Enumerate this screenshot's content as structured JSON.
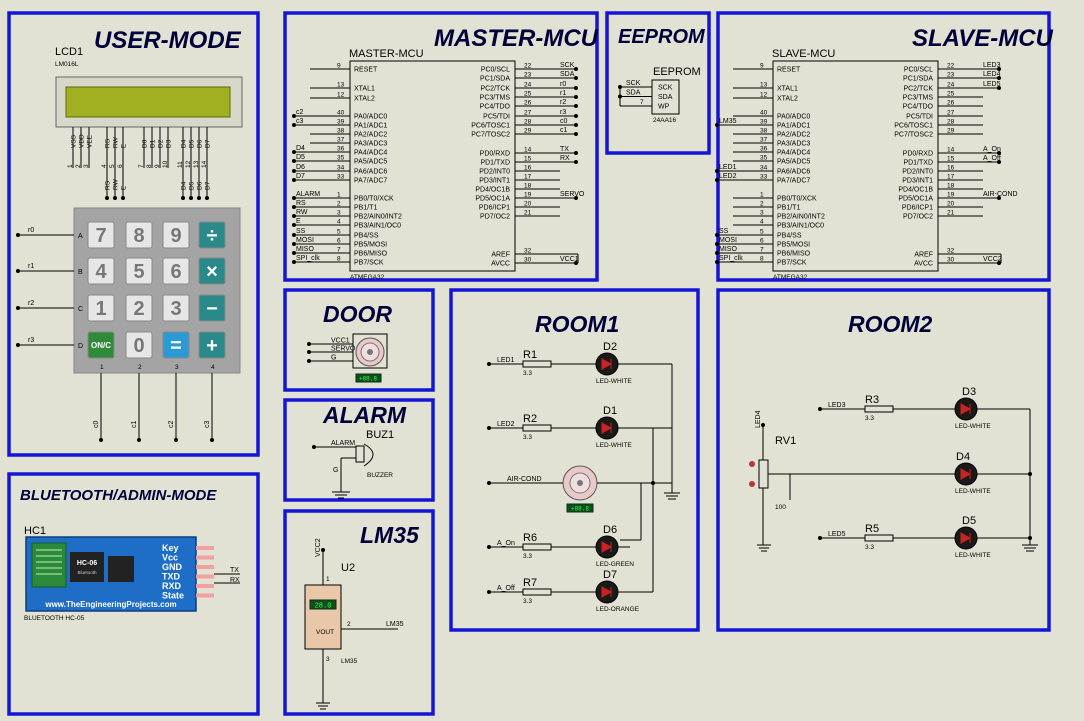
{
  "sections": {
    "user_mode": "USER-MODE",
    "bluetooth": "BLUETOOTH/ADMIN-MODE",
    "master": "MASTER-MCU",
    "eeprom": "EEPROM",
    "slave": "SLAVE-MCU",
    "door": "DOOR",
    "alarm": "ALARM",
    "lm35": "LM35",
    "room1": "ROOM1",
    "room2": "ROOM2"
  },
  "lcd": {
    "ref": "LCD1",
    "part": "LM016L",
    "pins": [
      "VSS",
      "VDD",
      "VEE",
      "RS",
      "RW",
      "E",
      "D0",
      "D1",
      "D2",
      "D3",
      "D4",
      "D5",
      "D6",
      "D7"
    ],
    "pin_nums": [
      "1",
      "2",
      "3",
      "4",
      "5",
      "6",
      "7",
      "8",
      "9",
      "10",
      "11",
      "12",
      "13",
      "14"
    ],
    "nets": [
      "RS",
      "RW",
      "E",
      "D4",
      "D5",
      "D6",
      "D7"
    ]
  },
  "keypad": {
    "keys": [
      "7",
      "8",
      "9",
      "÷",
      "4",
      "5",
      "6",
      "×",
      "1",
      "2",
      "3",
      "−",
      "ON/C",
      "0",
      "=",
      "+"
    ],
    "rows": [
      "A",
      "B",
      "C",
      "D"
    ],
    "cols": [
      "1",
      "2",
      "3",
      "4"
    ],
    "row_nets": [
      "r0",
      "r1",
      "r2",
      "r3"
    ],
    "col_nets": [
      "c0",
      "c1",
      "c2",
      "c3"
    ]
  },
  "master": {
    "ref": "MASTER-MCU",
    "part": "ATMEGA32",
    "left": [
      {
        "n": "9",
        "t": "RESET"
      },
      {
        "n": "13",
        "t": "XTAL1"
      },
      {
        "n": "12",
        "t": "XTAL2"
      },
      {
        "n": "40",
        "t": "PA0/ADC0"
      },
      {
        "n": "39",
        "t": "PA1/ADC1"
      },
      {
        "n": "38",
        "t": "PA2/ADC2"
      },
      {
        "n": "37",
        "t": "PA3/ADC3"
      },
      {
        "n": "36",
        "t": "PA4/ADC4"
      },
      {
        "n": "35",
        "t": "PA5/ADC5"
      },
      {
        "n": "34",
        "t": "PA6/ADC6"
      },
      {
        "n": "33",
        "t": "PA7/ADC7"
      },
      {
        "n": "1",
        "t": "PB0/T0/XCK"
      },
      {
        "n": "2",
        "t": "PB1/T1"
      },
      {
        "n": "3",
        "t": "PB2/AIN0/INT2"
      },
      {
        "n": "4",
        "t": "PB3/AIN1/OC0"
      },
      {
        "n": "5",
        "t": "PB4/SS"
      },
      {
        "n": "6",
        "t": "PB5/MOSI"
      },
      {
        "n": "7",
        "t": "PB6/MISO"
      },
      {
        "n": "8",
        "t": "PB7/SCK"
      }
    ],
    "right": [
      {
        "n": "22",
        "t": "PC0/SCL"
      },
      {
        "n": "23",
        "t": "PC1/SDA"
      },
      {
        "n": "24",
        "t": "PC2/TCK"
      },
      {
        "n": "25",
        "t": "PC3/TMS"
      },
      {
        "n": "26",
        "t": "PC4/TDO"
      },
      {
        "n": "27",
        "t": "PC5/TDI"
      },
      {
        "n": "28",
        "t": "PC6/TOSC1"
      },
      {
        "n": "29",
        "t": "PC7/TOSC2"
      },
      {
        "n": "14",
        "t": "PD0/RXD"
      },
      {
        "n": "15",
        "t": "PD1/TXD"
      },
      {
        "n": "16",
        "t": "PD2/INT0"
      },
      {
        "n": "17",
        "t": "PD3/INT1"
      },
      {
        "n": "18",
        "t": "PD4/OC1B"
      },
      {
        "n": "19",
        "t": "PD5/OC1A"
      },
      {
        "n": "20",
        "t": "PD6/ICP1"
      },
      {
        "n": "21",
        "t": "PD7/OC2"
      },
      {
        "n": "32",
        "t": "AREF"
      },
      {
        "n": "30",
        "t": "AVCC"
      }
    ],
    "left_nets": [
      "",
      "",
      "",
      "c2",
      "c3",
      "",
      "",
      "D4",
      "D5",
      "D6",
      "D7",
      "ALARM",
      "RS",
      "RW",
      "E",
      "SS",
      "MOSI",
      "MISO",
      "SPI_clk"
    ],
    "right_nets": [
      "SCK",
      "SDA",
      "r0",
      "r1",
      "r2",
      "r3",
      "c0",
      "c1",
      "TX",
      "RX",
      "",
      "",
      "",
      "SERVO",
      "",
      "",
      "",
      "VCC1"
    ]
  },
  "eeprom": {
    "title": "EEPROM",
    "part": "24AA16",
    "pins": [
      "SCK",
      "SDA",
      "WP"
    ],
    "nets": [
      "SCK",
      "SDA"
    ],
    "wp_num": "7"
  },
  "slave": {
    "ref": "SLAVE-MCU",
    "part": "ATMEGA32",
    "left_nets": [
      "",
      "",
      "",
      "",
      "LM35",
      "",
      "",
      "",
      "",
      "LED1",
      "LED2",
      "",
      "",
      "",
      "",
      "SS",
      "MOSI",
      "MISO",
      "SPI_clk"
    ],
    "right_nets": [
      "LED3",
      "LED4",
      "LED5",
      "",
      "",
      "",
      "",
      "",
      "A_On",
      "A_Off",
      "",
      "",
      "",
      "AIR-COND",
      "",
      "",
      "",
      "VCC2"
    ]
  },
  "door": {
    "nets": [
      "VCC1",
      "SERVO",
      "G"
    ],
    "readout": "+88.8"
  },
  "alarm": {
    "net": "ALARM",
    "ref": "BUZ1",
    "part": "BUZZER",
    "gnd": "G"
  },
  "lm35": {
    "ref": "U2",
    "part": "LM35",
    "vcc": "VCC2",
    "out": "VOUT",
    "net": "LM35",
    "readout": "28.0",
    "pin2": "2",
    "pin3": "3",
    "pin1": "1"
  },
  "room1": {
    "items": [
      {
        "net": "LED1",
        "res": "R1",
        "val": "3.3",
        "diode": "D2",
        "type": "LED-WHITE"
      },
      {
        "net": "LED2",
        "res": "R2",
        "val": "3.3",
        "diode": "D1",
        "type": "LED-WHITE"
      },
      {
        "net": "A_On",
        "res": "R6",
        "val": "3.3",
        "diode": "D6",
        "type": "LED-GREEN"
      },
      {
        "net": "A_Off",
        "res": "R7",
        "val": "3.3",
        "diode": "D7",
        "type": "LED-ORANGE"
      }
    ],
    "fan_net": "AIR-COND",
    "fan_readout": "+88.8"
  },
  "room2": {
    "items": [
      {
        "net": "LED3",
        "res": "R3",
        "val": "3.3",
        "diode": "D3",
        "type": "LED-WHITE"
      },
      {
        "net": "",
        "res": "",
        "val": "",
        "diode": "D4",
        "type": "LED-WHITE"
      },
      {
        "net": "LED5",
        "res": "R5",
        "val": "3.3",
        "diode": "D5",
        "type": "LED-WHITE"
      }
    ],
    "pot": {
      "ref": "RV1",
      "val": "100",
      "net": "LED4"
    }
  },
  "hc": {
    "ref": "HC1",
    "part": "BLUETOOTH HC-05",
    "chip": "HC-06",
    "brand": "Bluetooth",
    "pins": [
      "Key",
      "Vcc",
      "GND",
      "TXD",
      "RXD",
      "State"
    ],
    "nets": [
      "TX",
      "RX"
    ],
    "site": "www.TheEngineeringProjects.com"
  }
}
